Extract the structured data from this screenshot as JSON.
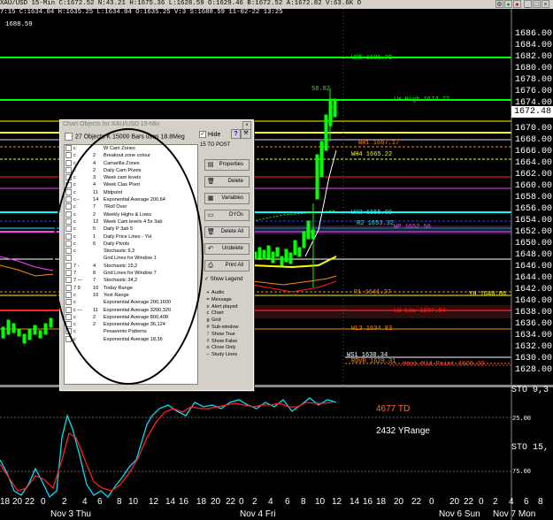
{
  "titlebar": {
    "text": "XAU/USD  15-Min  C:1672.52  N:43.21  H:1675.36  L:1628.59  O:1629.46  B:1672.52  A:1672.82  V:63.6K  O",
    "icons": [
      "settings-icon",
      "green-icon",
      "red-icon",
      "minimize-icon",
      "maximize-icon",
      "close-icon"
    ]
  },
  "subinfo": "7:15  C:1634.04  H:1635.25  L:1634.04  O:1635.25  V:3  S:1688.59  11-02-22  13:25",
  "axis_top_value": "1688.59",
  "y_axis": [
    "1686.00",
    "1684.00",
    "1682.00",
    "1680.00",
    "1678.00",
    "1676.00",
    "1674.00",
    "1672.48",
    "1670.00",
    "1668.00",
    "1666.00",
    "1664.00",
    "1662.00",
    "1660.00",
    "1658.00",
    "1656.00",
    "1654.00",
    "1652.00",
    "1650.00",
    "1648.00",
    "1646.00",
    "1644.00",
    "1642.00",
    "1640.00",
    "1638.00",
    "1636.00",
    "1634.00",
    "1632.00",
    "1630.00",
    "1628.00"
  ],
  "current_price": "1672.48",
  "levels": {
    "wh5": "WH5 1681.79",
    "lw_high": "LW High 1674.77",
    "peak": "58.82",
    "wr1": "WR1 1667.17",
    "wh4": "WH4 1665.22",
    "wh3": "WH3 1655.09",
    "r2": "R2 1653.32",
    "wp": "WP 1652.56",
    "r1": "R1 1641.27",
    "yh": "YH 1640.86",
    "lw_low": "LW Low 1637.94",
    "wl3": "WL3 1634.83",
    "ws1": "WS1 1630.34",
    "rdvr": "RDVR 1629.31",
    "yest_mid": "Yest Mid Point 1628.70"
  },
  "indicator": {
    "sto_label_1": "STO  9,3",
    "sto_label_2": "STO  15,",
    "level_25": "25.00",
    "level_75": "75.00",
    "td": "4677 TD",
    "yrange": "2432 YRange"
  },
  "x_axis": {
    "ticks": [
      "18",
      "20",
      "22",
      "0",
      "2",
      "4",
      "6",
      "8",
      "10",
      "12",
      "14",
      "16",
      "18",
      "20",
      "22",
      "0",
      "2",
      "4",
      "6",
      "8",
      "10",
      "12",
      "14",
      "16",
      "18",
      "20",
      "22",
      "0",
      "20",
      "22",
      "0",
      "2",
      "4",
      "6",
      "8"
    ],
    "dates": [
      "Nov 3 Thu",
      "Nov 4 Fri",
      "Nov 6 Sun",
      "Nov 7 Mon"
    ]
  },
  "dialog": {
    "title": "Chart Objects for XAU/USD 15-Min",
    "count_text": "27 Objects  K 15000 Bars  uses 18.8Meg",
    "hide_label": "Hide",
    "to_post": "15 TO POST",
    "buttons": [
      "Properties",
      "Delete",
      "Variables",
      "DYOs",
      "Delete All",
      "Undelete",
      "Print All"
    ],
    "show_legend": "Show Legend",
    "items": [
      {
        "pfx": "c",
        "num": "",
        "label": "W Cam Zones"
      },
      {
        "pfx": "c",
        "num": "2",
        "label": "Breakout zone colour"
      },
      {
        "pfx": "c",
        "num": "4",
        "label": "Camarilla Zones"
      },
      {
        "pfx": "c",
        "num": "2",
        "label": "Daily Cam Pivots"
      },
      {
        "pfx": "c",
        "num": "3",
        "label": "Week cam levels"
      },
      {
        "pfx": "c",
        "num": "4",
        "label": "Week Clas Pivot"
      },
      {
        "pfx": "c",
        "num": "11",
        "label": "Midpoint"
      },
      {
        "pfx": "c--",
        "num": "14",
        "label": "Exponential Average   200,64"
      },
      {
        "pfx": "c",
        "num": "7",
        "label": "7Roll Over"
      },
      {
        "pfx": "c",
        "num": "2",
        "label": "Weekly Highs & Lows"
      },
      {
        "pfx": "c",
        "num": "12",
        "label": "Week Cam levels 4 5x 3ab"
      },
      {
        "pfx": "c",
        "num": "5",
        "label": "Daily P 3ab 5"
      },
      {
        "pfx": "c",
        "num": "1",
        "label": "Daily Price Lines - YH"
      },
      {
        "pfx": "c",
        "num": "6",
        "label": "Daily Pivots"
      },
      {
        "pfx": "c",
        "num": "",
        "label": "Stochastic   9,3"
      },
      {
        "pfx": "",
        "num": "",
        "label": "Grid Lines for Window 1"
      },
      {
        "pfx": "7 -",
        "num": "4",
        "label": "Stochastic   15,2"
      },
      {
        "pfx": "7",
        "num": "8",
        "label": "Grid Lines for Window 7"
      },
      {
        "pfx": "7 ---",
        "num": "7",
        "label": "Stochastic   34,2"
      },
      {
        "pfx": "7 9",
        "num": "10",
        "label": "Today Range"
      },
      {
        "pfx": "c",
        "num": "10",
        "label": "Yest Range"
      },
      {
        "pfx": "c",
        "num": "",
        "label": "Exponential Average   200,1600"
      },
      {
        "pfx": "c ---",
        "num": "11",
        "label": "Exponential Average   3200,320"
      },
      {
        "pfx": "c",
        "num": "2",
        "label": "Exponential Average   800,408"
      },
      {
        "pfx": "c",
        "num": "2",
        "label": "Exponential Average   36,124"
      },
      {
        "pfx": "c",
        "num": "",
        "label": "Pesavento Patterns"
      },
      {
        "pfx": "c",
        "num": "",
        "label": "Exponential Average   18,36"
      }
    ],
    "legend": [
      {
        "sym": "+",
        "label": "Audio"
      },
      {
        "sym": "=",
        "label": "Message"
      },
      {
        "sym": "x",
        "label": "Alert played"
      },
      {
        "sym": "c",
        "label": "Chart"
      },
      {
        "sym": "g",
        "label": "Grid"
      },
      {
        "sym": "#",
        "label": "Sub-window"
      },
      {
        "sym": "!",
        "label": "Show True"
      },
      {
        "sym": "f",
        "label": "Show False"
      },
      {
        "sym": "o",
        "label": "Close Only"
      },
      {
        "sym": "--",
        "label": "Study Lines"
      }
    ]
  },
  "colors": {
    "green": "#00ff00",
    "yellow": "#ffff00",
    "orange": "#ff8c00",
    "red": "#ff2020",
    "cyan": "#00ffff",
    "magenta": "#ff40ff",
    "white": "#ffffff"
  }
}
